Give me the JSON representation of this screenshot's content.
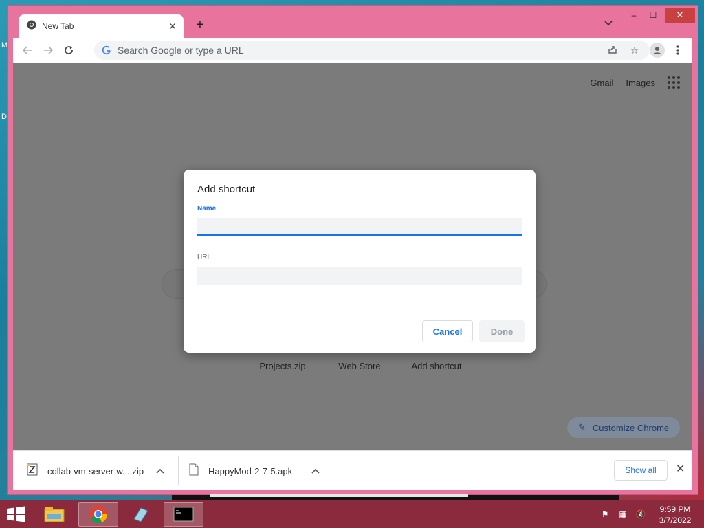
{
  "desktop": {
    "icon_labels": [
      "M",
      "D"
    ]
  },
  "browser": {
    "tab": {
      "title": "New Tab",
      "close_icon": "close-icon"
    },
    "window_controls": {
      "minimize": "–",
      "maximize": "☐",
      "close": "✕"
    },
    "omnibox": {
      "placeholder": "Search Google or type a URL"
    },
    "top_links": {
      "gmail": "Gmail",
      "images": "Images"
    },
    "shortcuts": [
      "Projects.zip",
      "Web Store",
      "Add shortcut"
    ],
    "customize_label": "Customize Chrome"
  },
  "dialog": {
    "title": "Add shortcut",
    "name_label": "Name",
    "name_value": "",
    "url_label": "URL",
    "url_value": "",
    "cancel_label": "Cancel",
    "done_label": "Done"
  },
  "downloads": {
    "items": [
      {
        "filename": "collab-vm-server-w....zip",
        "icon": "zip-file-icon"
      },
      {
        "filename": "HappyMod-2-7-5.apk",
        "icon": "file-icon"
      }
    ],
    "show_all_label": "Show all"
  },
  "taskbar": {
    "apps": [
      "file-explorer-icon",
      "chrome-icon",
      "notepad-icon",
      "cmd-icon"
    ],
    "time": "9:59 PM",
    "date": "3/7/2022"
  },
  "colors": {
    "window_frame": "#e8749e",
    "accent": "#1a73e8",
    "taskbar": "#8a2a3c",
    "overlay": "#7b7b7b"
  }
}
